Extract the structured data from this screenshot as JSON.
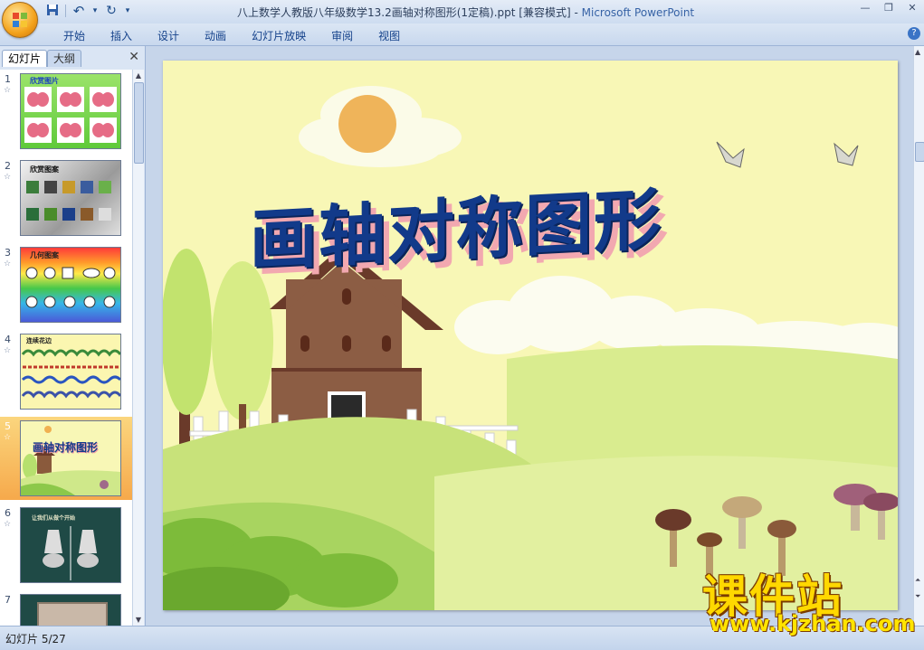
{
  "window": {
    "title": "八上数学人教版八年级数学13.2画轴对称图形(1定稿).ppt [兼容模式]",
    "separator": " - ",
    "app_name": "Microsoft PowerPoint"
  },
  "quick_access": [
    {
      "name": "save-icon",
      "glyph": "💾"
    },
    {
      "name": "undo-icon",
      "glyph": "↶"
    },
    {
      "name": "undo-dropdown-icon",
      "glyph": "▾"
    },
    {
      "name": "redo-icon",
      "glyph": "↻"
    },
    {
      "name": "customize-qat-icon",
      "glyph": "▾"
    }
  ],
  "window_controls": {
    "minimize": "—",
    "restore": "❐",
    "close": "✕"
  },
  "ribbon": {
    "tabs": [
      "开始",
      "插入",
      "设计",
      "动画",
      "幻灯片放映",
      "审阅",
      "视图"
    ],
    "help": "?"
  },
  "panel": {
    "tabs": [
      "幻灯片",
      "大纲"
    ],
    "close": "✕"
  },
  "thumbnails": [
    {
      "number": "1",
      "star": "☆",
      "title": "欣赏图片",
      "selected": false
    },
    {
      "number": "2",
      "star": "☆",
      "title": "欣赏图案",
      "selected": false
    },
    {
      "number": "3",
      "star": "☆",
      "title": "几何图案",
      "selected": false
    },
    {
      "number": "4",
      "star": "☆",
      "title": "连续花边",
      "selected": false
    },
    {
      "number": "5",
      "star": "☆",
      "title": "画轴对称图形",
      "selected": true
    },
    {
      "number": "6",
      "star": "☆",
      "title": "让我们从做个开始",
      "selected": false
    },
    {
      "number": "7",
      "star": "",
      "title": "",
      "selected": false
    }
  ],
  "slide": {
    "title": "画轴对称图形"
  },
  "status": {
    "slide_indicator": "幻灯片 5/27"
  },
  "watermark": {
    "main": "课件站",
    "url": "www.kjzhan.com"
  },
  "colors": {
    "accent": "#15428b",
    "slide_title": "#123a8a",
    "selection": "#f6a94b"
  }
}
